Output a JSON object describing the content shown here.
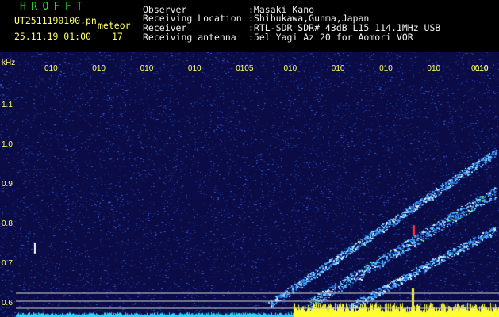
{
  "header": {
    "title": "HROFFT",
    "filename": "UT2511190100.pn",
    "mode": "meteor",
    "datetime": "25.11.19 01:00",
    "count": "17",
    "fields": [
      {
        "label": "Observer",
        "value": ":Masaki Kano"
      },
      {
        "label": "Receiving Location",
        "value": ":Shibukawa,Gunma,Japan"
      },
      {
        "label": "Receiver",
        "value": ":RTL-SDR SDR# 43dB L15 114.1MHz USB"
      },
      {
        "label": "Receiving antenna",
        "value": ":5el Yagi Az 20 for Aomori VOR"
      }
    ]
  },
  "spectrogram": {
    "unit": "kHz",
    "ticks": [
      "1.1",
      "1.0",
      "0.9",
      "0.8",
      "0.7",
      "0.6"
    ],
    "time_labels": [
      "010",
      "010",
      "010",
      "010",
      "0105",
      "010",
      "010",
      "010",
      "010",
      "010",
      "0110"
    ],
    "colors": {
      "background": "#0b0b46",
      "noise": "#1e3aa0",
      "trace": "#3db8ff",
      "hot": "#ff3030",
      "signal": "#ffff30",
      "baseline": "#30d8ff",
      "grid": "#c8c8c8"
    }
  }
}
